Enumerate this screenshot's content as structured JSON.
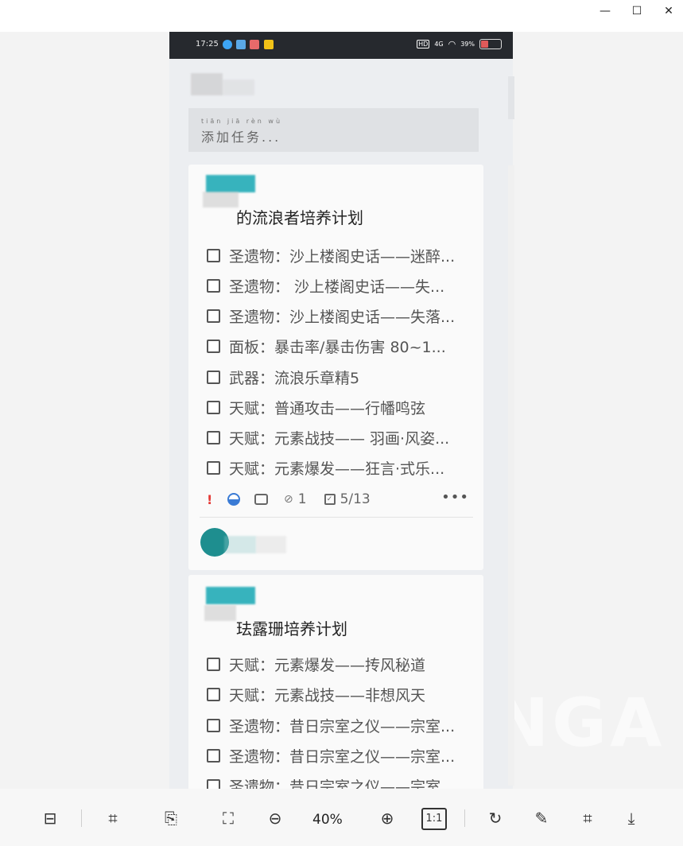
{
  "window": {
    "minimize_glyph": "—",
    "maximize_glyph": "☐",
    "close_glyph": "✕"
  },
  "phone": {
    "status_time": "17:25",
    "status_network": "4G",
    "battery_percent": "39%"
  },
  "add_task": {
    "pinyin": "tiān jiā rèn wù",
    "placeholder": "添加任务..."
  },
  "cards": [
    {
      "title": "的流浪者培养计划",
      "items": [
        "圣遗物：沙上楼阁史话——迷醉...",
        "圣遗物： 沙上楼阁史话——失...",
        "圣遗物：沙上楼阁史话——失落...",
        "面板：暴击率/暴击伤害  80~1...",
        "武器：流浪乐章精5",
        "天赋：普通攻击——行幡鸣弦",
        "天赋：元素战技—— 羽画·风姿...",
        "天赋：元素爆发——狂言·式乐..."
      ],
      "meta": {
        "priority_mark": "!",
        "attachments": "1",
        "progress": "5/13",
        "more": "•••"
      }
    },
    {
      "title": "珐露珊培养计划",
      "items": [
        "天赋：元素爆发——抟风秘道",
        "天赋：元素战技——非想风天",
        "圣遗物：昔日宗室之仪——宗室...",
        "圣遗物：昔日宗室之仪——宗室...",
        "圣遗物：昔日宗室之仪——宗室..."
      ]
    }
  ],
  "toolbar": {
    "zoom_level": "40%",
    "one_to_one": "1:1"
  },
  "colors": {
    "status_bar": "#26292e",
    "accent_teal": "#16a7b3",
    "priority_red": "#e53935"
  }
}
